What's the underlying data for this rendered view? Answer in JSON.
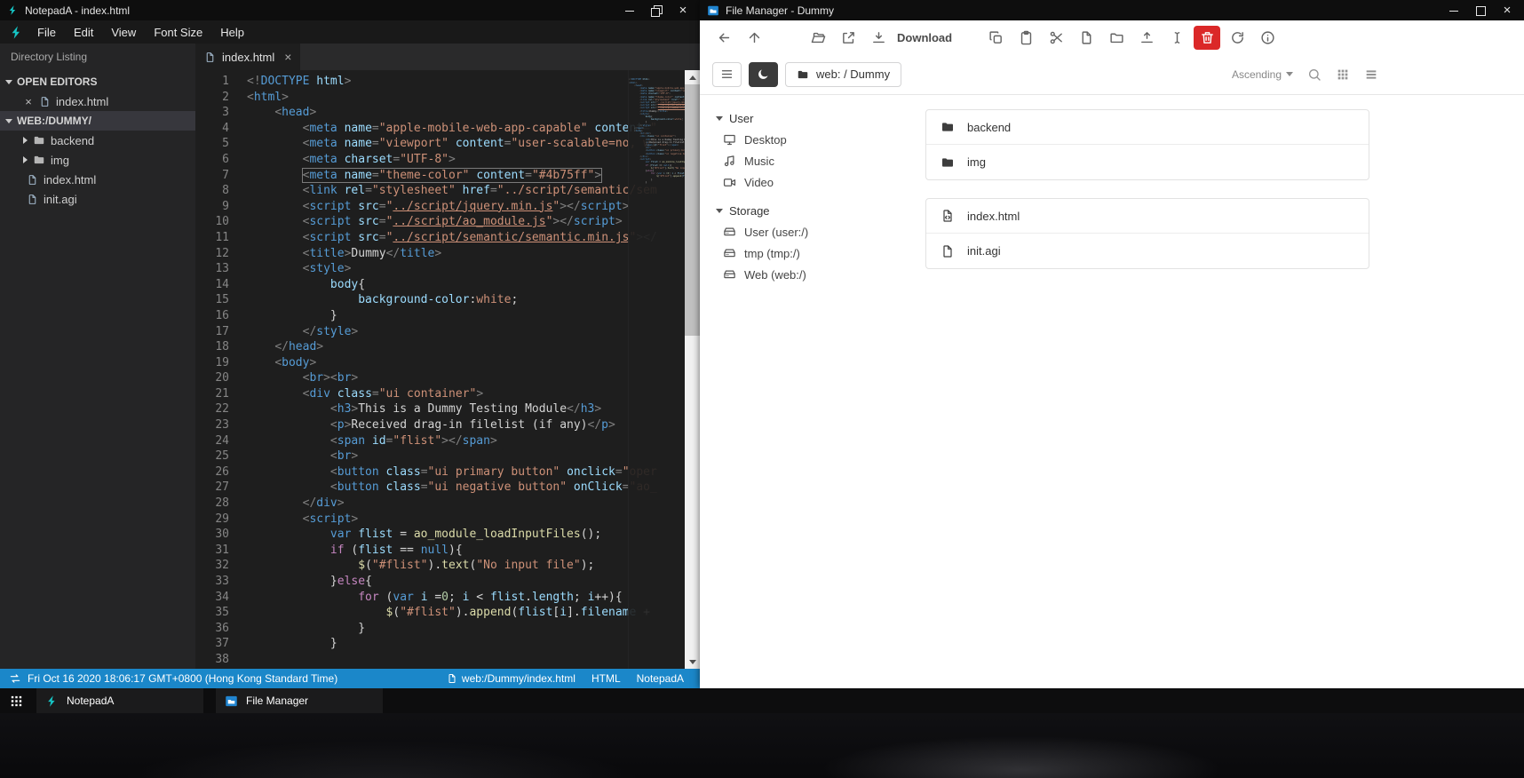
{
  "colors": {
    "statusbar_blue": "#1b87c9",
    "notepada_teal": "#16c5c5",
    "danger_red": "#db2828",
    "filemanager_blue": "#2185d0",
    "editor_bg": "#1e1e1e"
  },
  "notepad": {
    "window_title": "NotepadA - index.html",
    "menu": [
      "File",
      "Edit",
      "View",
      "Font Size",
      "Help"
    ],
    "explorer": {
      "header": "Directory Listing",
      "open_editors_label": "OPEN EDITORS",
      "open_editor_file": "index.html",
      "workspace_label": "WEB:/DUMMY/",
      "tree": [
        {
          "name": "backend",
          "kind": "folder"
        },
        {
          "name": "img",
          "kind": "folder"
        },
        {
          "name": "index.html",
          "kind": "file"
        },
        {
          "name": "init.agi",
          "kind": "file"
        }
      ]
    },
    "tab": "index.html",
    "statusbar": {
      "datetime": "Fri Oct 16 2020 18:06:17 GMT+0800 (Hong Kong Standard Time)",
      "file_path": "web:/Dummy/index.html",
      "language": "HTML",
      "app_name": "NotepadA"
    },
    "editor": {
      "boxed_line": 7,
      "lines": [
        [
          [
            "g",
            "<!"
          ],
          [
            "t",
            "DOCTYPE"
          ],
          [
            "w",
            " "
          ],
          [
            "a",
            "html"
          ],
          [
            "g",
            ">"
          ]
        ],
        [
          [
            "g",
            "<"
          ],
          [
            "t",
            "html"
          ],
          [
            "g",
            ">"
          ]
        ],
        [
          [
            "w",
            "    "
          ],
          [
            "g",
            "<"
          ],
          [
            "t",
            "head"
          ],
          [
            "g",
            ">"
          ]
        ],
        [
          [
            "w",
            "        "
          ],
          [
            "g",
            "<"
          ],
          [
            "t",
            "meta"
          ],
          [
            "w",
            " "
          ],
          [
            "a",
            "name"
          ],
          [
            "g",
            "="
          ],
          [
            "s",
            "\"apple-mobile-web-app-capable\""
          ],
          [
            "w",
            " "
          ],
          [
            "a",
            "content"
          ],
          [
            "g",
            "="
          ],
          [
            "s",
            "\""
          ]
        ],
        [
          [
            "w",
            "        "
          ],
          [
            "g",
            "<"
          ],
          [
            "t",
            "meta"
          ],
          [
            "w",
            " "
          ],
          [
            "a",
            "name"
          ],
          [
            "g",
            "="
          ],
          [
            "s",
            "\"viewport\""
          ],
          [
            "w",
            " "
          ],
          [
            "a",
            "content"
          ],
          [
            "g",
            "="
          ],
          [
            "s",
            "\"user-scalable=no, wi"
          ]
        ],
        [
          [
            "w",
            "        "
          ],
          [
            "g",
            "<"
          ],
          [
            "t",
            "meta"
          ],
          [
            "w",
            " "
          ],
          [
            "a",
            "charset"
          ],
          [
            "g",
            "="
          ],
          [
            "s",
            "\"UTF-8\""
          ],
          [
            "g",
            ">"
          ]
        ],
        [
          [
            "w",
            "        "
          ],
          [
            "g",
            "<"
          ],
          [
            "t",
            "meta"
          ],
          [
            "w",
            " "
          ],
          [
            "a",
            "name"
          ],
          [
            "g",
            "="
          ],
          [
            "s",
            "\"theme-color\""
          ],
          [
            "w",
            " "
          ],
          [
            "a",
            "content"
          ],
          [
            "g",
            "="
          ],
          [
            "s",
            "\"#4b75ff\""
          ],
          [
            "g",
            ">"
          ]
        ],
        [
          [
            "w",
            "        "
          ],
          [
            "g",
            "<"
          ],
          [
            "t",
            "link"
          ],
          [
            "w",
            " "
          ],
          [
            "a",
            "rel"
          ],
          [
            "g",
            "="
          ],
          [
            "s",
            "\"stylesheet\""
          ],
          [
            "w",
            " "
          ],
          [
            "a",
            "href"
          ],
          [
            "g",
            "="
          ],
          [
            "s",
            "\"../script/semantic/sem"
          ]
        ],
        [
          [
            "w",
            "        "
          ],
          [
            "g",
            "<"
          ],
          [
            "t",
            "script"
          ],
          [
            "w",
            " "
          ],
          [
            "a",
            "src"
          ],
          [
            "g",
            "="
          ],
          [
            "s",
            "\""
          ],
          [
            "u",
            "../script/jquery.min.js"
          ],
          [
            "s",
            "\""
          ],
          [
            "g",
            "></"
          ],
          [
            "t",
            "script"
          ],
          [
            "g",
            ">"
          ]
        ],
        [
          [
            "w",
            "        "
          ],
          [
            "g",
            "<"
          ],
          [
            "t",
            "script"
          ],
          [
            "w",
            " "
          ],
          [
            "a",
            "src"
          ],
          [
            "g",
            "="
          ],
          [
            "s",
            "\""
          ],
          [
            "u",
            "../script/ao_module.js"
          ],
          [
            "s",
            "\""
          ],
          [
            "g",
            "></"
          ],
          [
            "t",
            "script"
          ],
          [
            "g",
            ">"
          ]
        ],
        [
          [
            "w",
            "        "
          ],
          [
            "g",
            "<"
          ],
          [
            "t",
            "script"
          ],
          [
            "w",
            " "
          ],
          [
            "a",
            "src"
          ],
          [
            "g",
            "="
          ],
          [
            "s",
            "\""
          ],
          [
            "u",
            "../script/semantic/semantic.min.js"
          ],
          [
            "s",
            "\""
          ],
          [
            "g",
            "></"
          ]
        ],
        [
          [
            "w",
            "        "
          ],
          [
            "g",
            "<"
          ],
          [
            "t",
            "title"
          ],
          [
            "g",
            ">"
          ],
          [
            "w",
            "Dummy"
          ],
          [
            "g",
            "</"
          ],
          [
            "t",
            "title"
          ],
          [
            "g",
            ">"
          ]
        ],
        [
          [
            "w",
            "        "
          ],
          [
            "g",
            "<"
          ],
          [
            "t",
            "style"
          ],
          [
            "g",
            ">"
          ]
        ],
        [
          [
            "w",
            "            "
          ],
          [
            "a",
            "body"
          ],
          [
            "w",
            "{"
          ]
        ],
        [
          [
            "w",
            "                "
          ],
          [
            "a",
            "background-color"
          ],
          [
            "w",
            ":"
          ],
          [
            "s",
            "white"
          ],
          [
            "w",
            ";"
          ]
        ],
        [
          [
            "w",
            "            }"
          ]
        ],
        [
          [
            "w",
            "        "
          ],
          [
            "g",
            "</"
          ],
          [
            "t",
            "style"
          ],
          [
            "g",
            ">"
          ]
        ],
        [
          [
            "w",
            "    "
          ],
          [
            "g",
            "</"
          ],
          [
            "t",
            "head"
          ],
          [
            "g",
            ">"
          ]
        ],
        [
          [
            "w",
            "    "
          ],
          [
            "g",
            "<"
          ],
          [
            "t",
            "body"
          ],
          [
            "g",
            ">"
          ]
        ],
        [
          [
            "w",
            "        "
          ],
          [
            "g",
            "<"
          ],
          [
            "t",
            "br"
          ],
          [
            "g",
            "><"
          ],
          [
            "t",
            "br"
          ],
          [
            "g",
            ">"
          ]
        ],
        [
          [
            "w",
            "        "
          ],
          [
            "g",
            "<"
          ],
          [
            "t",
            "div"
          ],
          [
            "w",
            " "
          ],
          [
            "a",
            "class"
          ],
          [
            "g",
            "="
          ],
          [
            "s",
            "\"ui container\""
          ],
          [
            "g",
            ">"
          ]
        ],
        [
          [
            "w",
            "            "
          ],
          [
            "g",
            "<"
          ],
          [
            "t",
            "h3"
          ],
          [
            "g",
            ">"
          ],
          [
            "w",
            "This is a Dummy Testing Module"
          ],
          [
            "g",
            "</"
          ],
          [
            "t",
            "h3"
          ],
          [
            "g",
            ">"
          ]
        ],
        [
          [
            "w",
            "            "
          ],
          [
            "g",
            "<"
          ],
          [
            "t",
            "p"
          ],
          [
            "g",
            ">"
          ],
          [
            "w",
            "Received drag-in filelist (if any)"
          ],
          [
            "g",
            "</"
          ],
          [
            "t",
            "p"
          ],
          [
            "g",
            ">"
          ]
        ],
        [
          [
            "w",
            "            "
          ],
          [
            "g",
            "<"
          ],
          [
            "t",
            "span"
          ],
          [
            "w",
            " "
          ],
          [
            "a",
            "id"
          ],
          [
            "g",
            "="
          ],
          [
            "s",
            "\"flist\""
          ],
          [
            "g",
            "></"
          ],
          [
            "t",
            "span"
          ],
          [
            "g",
            ">"
          ]
        ],
        [
          [
            "w",
            "            "
          ],
          [
            "g",
            "<"
          ],
          [
            "t",
            "br"
          ],
          [
            "g",
            ">"
          ]
        ],
        [
          [
            "w",
            "            "
          ],
          [
            "g",
            "<"
          ],
          [
            "t",
            "button"
          ],
          [
            "w",
            " "
          ],
          [
            "a",
            "class"
          ],
          [
            "g",
            "="
          ],
          [
            "s",
            "\"ui primary button\""
          ],
          [
            "w",
            " "
          ],
          [
            "a",
            "onclick"
          ],
          [
            "g",
            "="
          ],
          [
            "s",
            "\"oper"
          ]
        ],
        [
          [
            "w",
            "            "
          ],
          [
            "g",
            "<"
          ],
          [
            "t",
            "button"
          ],
          [
            "w",
            " "
          ],
          [
            "a",
            "class"
          ],
          [
            "g",
            "="
          ],
          [
            "s",
            "\"ui negative button\""
          ],
          [
            "w",
            " "
          ],
          [
            "a",
            "onClick"
          ],
          [
            "g",
            "="
          ],
          [
            "s",
            "\"ao_"
          ]
        ],
        [
          [
            "w",
            "        "
          ],
          [
            "g",
            "</"
          ],
          [
            "t",
            "div"
          ],
          [
            "g",
            ">"
          ]
        ],
        [
          [
            "w",
            "        "
          ],
          [
            "g",
            "<"
          ],
          [
            "t",
            "script"
          ],
          [
            "g",
            ">"
          ]
        ],
        [
          [
            "w",
            "            "
          ],
          [
            "k",
            "var"
          ],
          [
            "w",
            " "
          ],
          [
            "v",
            "flist"
          ],
          [
            "w",
            " = "
          ],
          [
            "f",
            "ao_module_loadInputFiles"
          ],
          [
            "w",
            "();"
          ]
        ],
        [
          [
            "w",
            "            "
          ],
          [
            "c",
            "if"
          ],
          [
            "w",
            " ("
          ],
          [
            "v",
            "flist"
          ],
          [
            "w",
            " == "
          ],
          [
            "k",
            "null"
          ],
          [
            "w",
            "){"
          ]
        ],
        [
          [
            "w",
            "                "
          ],
          [
            "f",
            "$"
          ],
          [
            "w",
            "("
          ],
          [
            "s",
            "\"#flist\""
          ],
          [
            "w",
            ")."
          ],
          [
            "f",
            "text"
          ],
          [
            "w",
            "("
          ],
          [
            "s",
            "\"No input file\""
          ],
          [
            "w",
            ");"
          ]
        ],
        [
          [
            "w",
            "            }"
          ],
          [
            "c",
            "else"
          ],
          [
            "w",
            "{"
          ]
        ],
        [
          [
            "w",
            "                "
          ],
          [
            "c",
            "for"
          ],
          [
            "w",
            " ("
          ],
          [
            "k",
            "var"
          ],
          [
            "w",
            " "
          ],
          [
            "v",
            "i"
          ],
          [
            "w",
            " ="
          ],
          [
            "n",
            "0"
          ],
          [
            "w",
            "; "
          ],
          [
            "v",
            "i"
          ],
          [
            "w",
            " < "
          ],
          [
            "v",
            "flist"
          ],
          [
            "w",
            "."
          ],
          [
            "a",
            "length"
          ],
          [
            "w",
            "; "
          ],
          [
            "v",
            "i"
          ],
          [
            "w",
            "++){"
          ]
        ],
        [
          [
            "w",
            "                    "
          ],
          [
            "f",
            "$"
          ],
          [
            "w",
            "("
          ],
          [
            "s",
            "\"#flist\""
          ],
          [
            "w",
            ")."
          ],
          [
            "f",
            "append"
          ],
          [
            "w",
            "("
          ],
          [
            "v",
            "flist"
          ],
          [
            "w",
            "["
          ],
          [
            "v",
            "i"
          ],
          [
            "w",
            "]."
          ],
          [
            "a",
            "filename"
          ],
          [
            "w",
            " + "
          ]
        ],
        [
          [
            "w",
            "                }"
          ]
        ],
        [
          [
            "w",
            "            }"
          ]
        ],
        [
          [
            "w",
            " "
          ]
        ]
      ]
    }
  },
  "filemanager": {
    "window_title": "File Manager - Dummy",
    "toolbar": {
      "download_label": "Download"
    },
    "breadcrumb": "web: / Dummy",
    "sort_order": "Ascending",
    "sidebar": {
      "sections": [
        {
          "label": "User",
          "items": [
            {
              "label": "Desktop",
              "icon": "desktop-icon"
            },
            {
              "label": "Music",
              "icon": "music-icon"
            },
            {
              "label": "Video",
              "icon": "video-icon"
            }
          ]
        },
        {
          "label": "Storage",
          "items": [
            {
              "label": "User (user:/)",
              "icon": "drive-icon"
            },
            {
              "label": "tmp (tmp:/)",
              "icon": "drive-icon"
            },
            {
              "label": "Web (web:/)",
              "icon": "drive-icon"
            }
          ]
        }
      ]
    },
    "file_groups": [
      [
        {
          "name": "backend",
          "icon": "folder-icon"
        },
        {
          "name": "img",
          "icon": "folder-icon"
        }
      ],
      [
        {
          "name": "index.html",
          "icon": "file-code-icon"
        },
        {
          "name": "init.agi",
          "icon": "file-icon"
        }
      ]
    ]
  },
  "taskbar": {
    "items": [
      {
        "label": "NotepadA",
        "icon": "notepada-logo"
      },
      {
        "label": "File Manager",
        "icon": "file-manager-icon"
      }
    ]
  }
}
